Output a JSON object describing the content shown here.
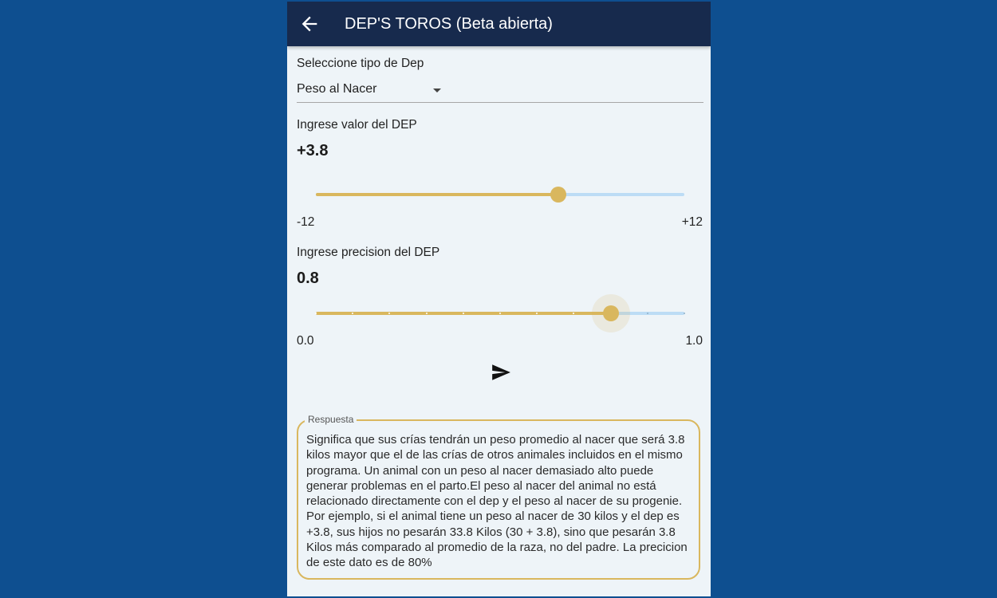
{
  "appbar": {
    "title": "DEP'S TOROS (Beta abierta)",
    "back_icon": "arrow-back-icon"
  },
  "dep_type": {
    "label": "Seleccione tipo de Dep",
    "selected": "Peso al Nacer"
  },
  "dep_value": {
    "label": "Ingrese valor del DEP",
    "value_text": "+3.8",
    "value": 3.8,
    "min": -12,
    "max": 12,
    "min_label": "-12",
    "max_label": "+12"
  },
  "dep_precision": {
    "label": "Ingrese precision del DEP",
    "value_text": "0.8",
    "value": 0.8,
    "min": 0,
    "max": 1,
    "divisions": 10,
    "min_label": "0.0",
    "max_label": "1.0"
  },
  "send_icon": "send-icon",
  "response": {
    "label": "Respuesta",
    "text": "Significa que sus crías tendrán un peso promedio al nacer que será 3.8 kilos mayor que el de las crías de otros animales incluidos en el mismo programa. Un animal con un peso al nacer demasiado alto puede generar problemas en el parto.El peso al nacer del animal no está relacionado directamente con el dep y el peso al nacer de su progenie. Por ejemplo, si el animal tiene un peso al nacer de 30 kilos y el dep es +3.8, sus hijos no pesarán 33.8 Kilos (30 + 3.8), sino que pesarán 3.8 Kilos más comparado al promedio de la raza, no del padre. La precicion de este dato es de 80%"
  },
  "colors": {
    "appbar": "#172a4d",
    "background": "#0e4f90",
    "accent": "#d9b75e",
    "inactive_track": "#bcdcf5"
  }
}
